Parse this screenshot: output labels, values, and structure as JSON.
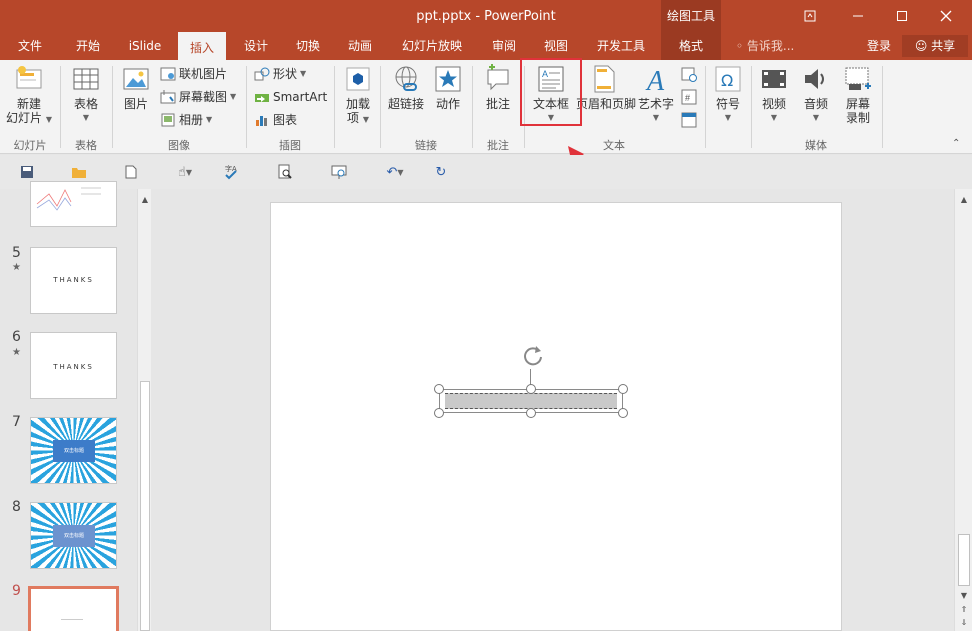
{
  "window": {
    "title": "ppt.pptx - PowerPoint",
    "context_tools": "绘图工具",
    "minimize_icon": "minimize-icon",
    "maximize_icon": "maximize-icon",
    "close_icon": "close-icon"
  },
  "tabs": [
    {
      "label": "文件"
    },
    {
      "label": "开始"
    },
    {
      "label": "iSlide"
    },
    {
      "label": "插入",
      "active": true
    },
    {
      "label": "设计"
    },
    {
      "label": "切换"
    },
    {
      "label": "动画"
    },
    {
      "label": "幻灯片放映"
    },
    {
      "label": "审阅"
    },
    {
      "label": "视图"
    },
    {
      "label": "开发工具"
    },
    {
      "label": "格式"
    }
  ],
  "tell_me": "告诉我...",
  "login": "登录",
  "share": "共享",
  "ribbon": {
    "groups": {
      "slides": "幻灯片",
      "tables": "表格",
      "images": "图像",
      "illustrations": "插图",
      "links": "链接",
      "comments": "批注",
      "text": "文本",
      "media": "媒体"
    },
    "new_slide": [
      "新建",
      "幻灯片"
    ],
    "table": "表格",
    "picture": "图片",
    "online_pictures": "联机图片",
    "screenshot": "屏幕截图",
    "album": "相册",
    "shapes": "形状",
    "smartart": "SmartArt",
    "chart": "图表",
    "addins": [
      "加载",
      "项"
    ],
    "hyperlink": "超链接",
    "action": "动作",
    "comment": "批注",
    "textbox": "文本框",
    "header_footer": "页眉和页脚",
    "wordart": "艺术字",
    "symbol": "符号",
    "video": "视频",
    "audio": "音频",
    "screen_recording": [
      "屏幕",
      "录制"
    ]
  },
  "slides": [
    {
      "number": "5",
      "text": "THANKS",
      "starred": true
    },
    {
      "number": "6",
      "text": "THANKS",
      "starred": true
    },
    {
      "number": "7",
      "text": "双击标题"
    },
    {
      "number": "8",
      "text": "双击标题"
    },
    {
      "number": "9",
      "text": ""
    }
  ],
  "colors": {
    "accent": "#b7472a",
    "highlight": "#e0323a"
  }
}
